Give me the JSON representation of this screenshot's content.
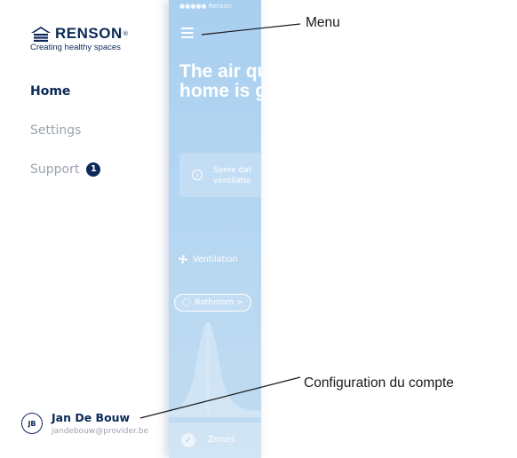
{
  "drawer": {
    "brand": {
      "name": "RENSON",
      "registered": "®",
      "tagline": "Creating healthy spaces"
    },
    "nav": [
      {
        "label": "Home",
        "active": true
      },
      {
        "label": "Settings",
        "active": false
      },
      {
        "label": "Support",
        "active": false,
        "badge": "1"
      }
    ],
    "account": {
      "initials": "JB",
      "name": "Jan De Bouw",
      "email": "jandebouw@provider.be"
    }
  },
  "screen": {
    "status_bar": "●●●●● Renson",
    "headline_line1": "The air qu",
    "headline_line2": "home is g",
    "info": {
      "line1": "Some dat",
      "line2": "ventilatio"
    },
    "ventilation_label": "Ventilation",
    "room_label": "Bathroom >",
    "zones_label": "Zones"
  },
  "annotations": {
    "menu": "Menu",
    "account_config": "Configuration du compte"
  },
  "colors": {
    "navy": "#0b2a57",
    "muted": "#9aa3ae",
    "screen_blue": "#a9cff0"
  },
  "icons": [
    "renson-house-logo-icon",
    "hamburger-menu-icon",
    "info-icon",
    "fan-icon",
    "drop-icon",
    "check-icon"
  ]
}
